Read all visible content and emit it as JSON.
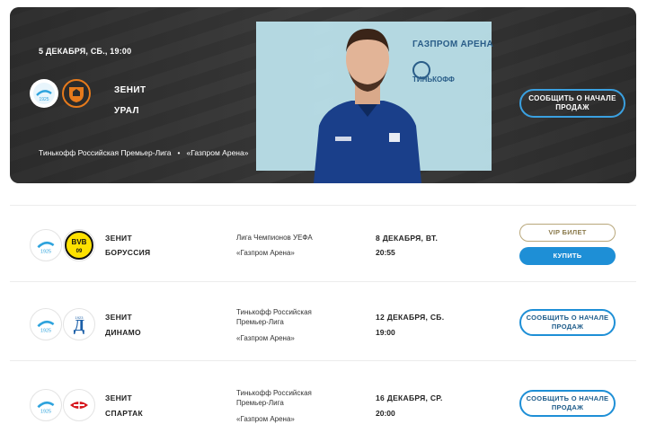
{
  "featured": {
    "date": "5 ДЕКАБРЯ, СБ., 19:00",
    "home_team": "ЗЕНИТ",
    "away_team": "УРАЛ",
    "tournament": "Тинькофф Российская Премьер-Лига",
    "separator": "•",
    "venue": "«Газпром Арена»",
    "button_label": "СООБЩИТЬ О НАЧАЛЕ ПРОДАЖ",
    "billboard_title": "ГАЗПРОМ АРЕНА",
    "billboard_rpl": "ТИНЬКОФФ",
    "background_text": "ЗЕНИТ"
  },
  "matches": [
    {
      "home_team": "ЗЕНИТ",
      "away_team": "БОРУССИЯ",
      "tournament": "Лига Чемпионов УЕФА",
      "venue": "«Газпром Арена»",
      "date": "8 ДЕКАБРЯ, ВТ.",
      "time": "20:55",
      "vip_label": "VIP БИЛЕТ",
      "buy_label": "КУПИТЬ"
    },
    {
      "home_team": "ЗЕНИТ",
      "away_team": "ДИНАМО",
      "tournament": "Тинькофф Российская Премьер-Лига",
      "venue": "«Газпром Арена»",
      "date": "12 ДЕКАБРЯ, СБ.",
      "time": "19:00",
      "notify_label": "СООБЩИТЬ О НАЧАЛЕ ПРОДАЖ"
    },
    {
      "home_team": "ЗЕНИТ",
      "away_team": "СПАРТАК",
      "tournament": "Тинькофф Российская Премьер-Лига",
      "venue": "«Газпром Арена»",
      "date": "16 ДЕКАБРЯ, СР.",
      "time": "20:00",
      "notify_label": "СООБЩИТЬ О НАЧАЛЕ ПРОДАЖ"
    }
  ],
  "colors": {
    "accent_blue": "#1e8fd6",
    "zenit_blue": "#2ea3dd",
    "vip_gold": "#b8a77b",
    "hero_dark": "#3b3b3b"
  },
  "icons": {
    "zenit": "zenit-logo-icon",
    "ural": "ural-logo-icon",
    "borussia": "bvb-logo-icon",
    "dinamo": "dinamo-logo-icon",
    "spartak": "spartak-logo-icon"
  }
}
